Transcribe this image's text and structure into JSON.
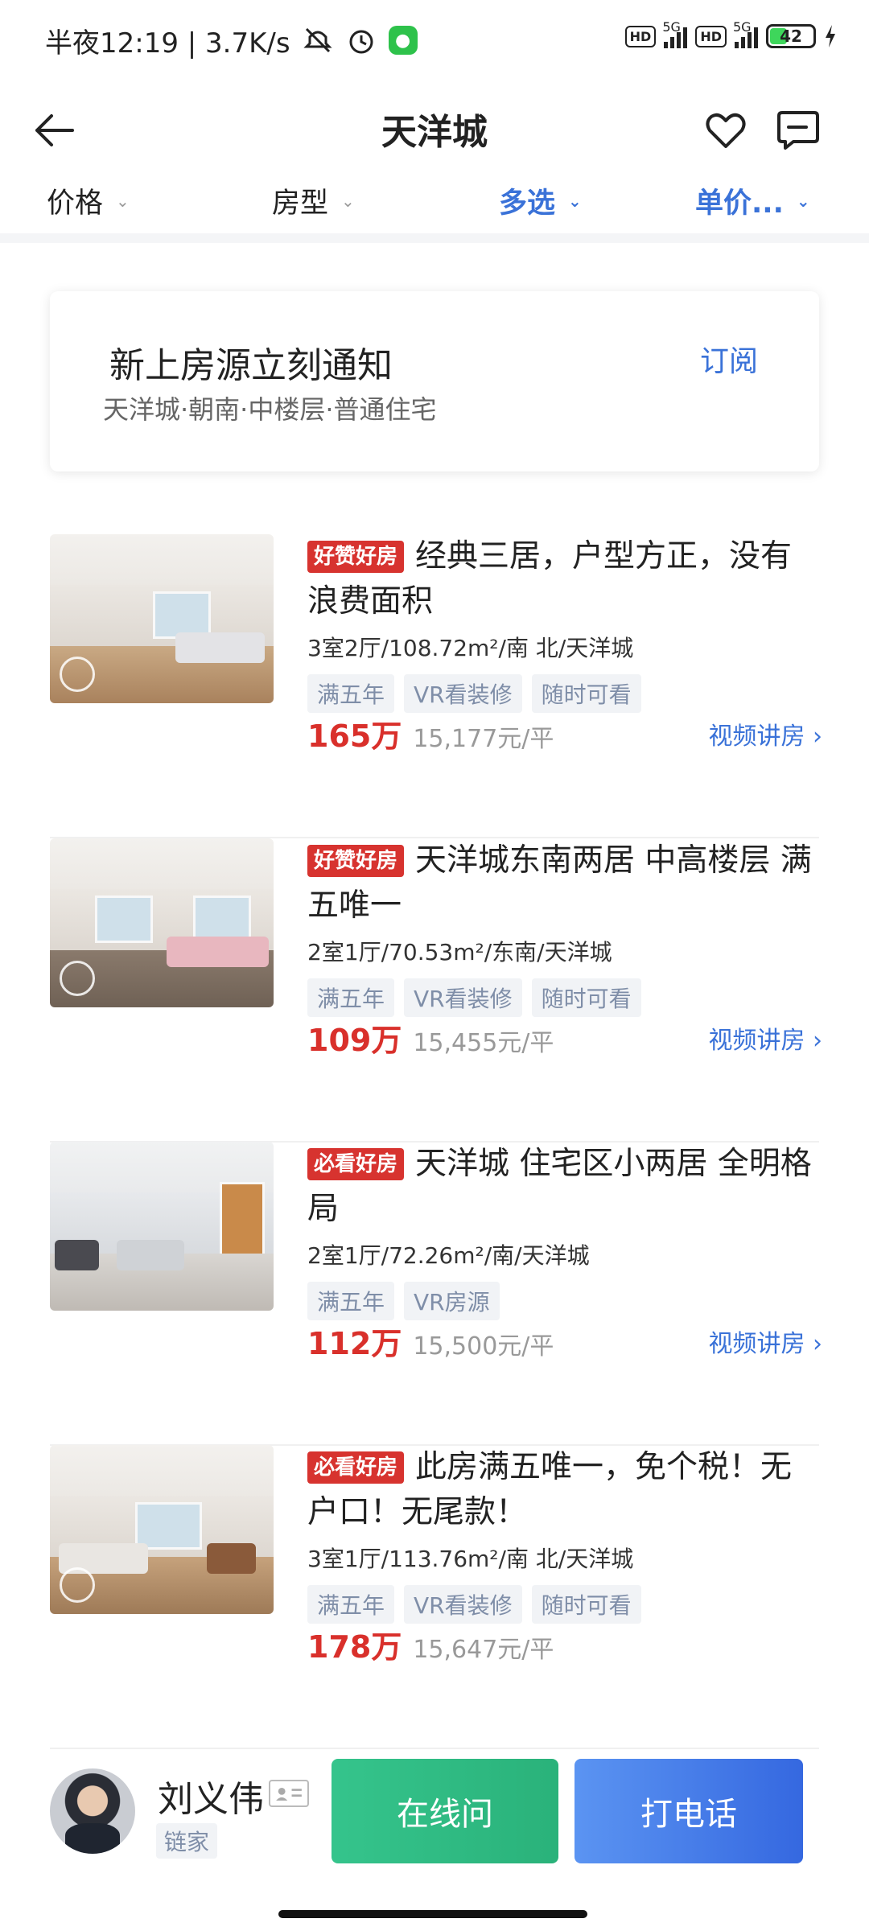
{
  "status_bar": {
    "time_text": "半夜12:19 | 3.7K/s",
    "network_label": "5G",
    "hd_label": "HD",
    "battery_level": "42"
  },
  "nav": {
    "title": "天洋城"
  },
  "filters": [
    {
      "label": "价格",
      "active": false
    },
    {
      "label": "房型",
      "active": false
    },
    {
      "label": "多选",
      "active": true
    },
    {
      "label": "单价...",
      "active": true
    }
  ],
  "subscribe": {
    "title": "新上房源立刻通知",
    "description": "天洋城·朝南·中楼层·普通住宅",
    "action": "订阅"
  },
  "listings": [
    {
      "badge": "好赞好房",
      "title": "经典三居，户型方正，没有浪费面积",
      "meta": "3室2厅/108.72m²/南 北/天洋城",
      "tags": [
        "满五年",
        "VR看装修",
        "随时可看"
      ],
      "price": "165万",
      "unit_price": "15,177元/平",
      "video": "视频讲房"
    },
    {
      "badge": "好赞好房",
      "title": "天洋城东南两居 中高楼层 满五唯一",
      "meta": "2室1厅/70.53m²/东南/天洋城",
      "tags": [
        "满五年",
        "VR看装修",
        "随时可看"
      ],
      "price": "109万",
      "unit_price": "15,455元/平",
      "video": "视频讲房"
    },
    {
      "badge": "必看好房",
      "title": "天洋城 住宅区小两居 全明格局",
      "meta": "2室1厅/72.26m²/南/天洋城",
      "tags": [
        "满五年",
        "VR房源"
      ],
      "price": "112万",
      "unit_price": "15,500元/平",
      "video": "视频讲房"
    },
    {
      "badge": "必看好房",
      "title": "此房满五唯一，免个税！无户口！无尾款！",
      "meta": "3室1厅/113.76m²/南 北/天洋城",
      "tags": [
        "满五年",
        "VR看装修",
        "随时可看"
      ],
      "price": "178万",
      "unit_price": "15,647元/平",
      "video": ""
    }
  ],
  "agent": {
    "name": "刘义伟",
    "company": "链家",
    "chat_button": "在线问",
    "call_button": "打电话"
  },
  "colors": {
    "accent_blue": "#3a72d8",
    "price_red": "#d9302b",
    "chat_green": "#2ab27a",
    "call_blue": "#3568e0"
  }
}
